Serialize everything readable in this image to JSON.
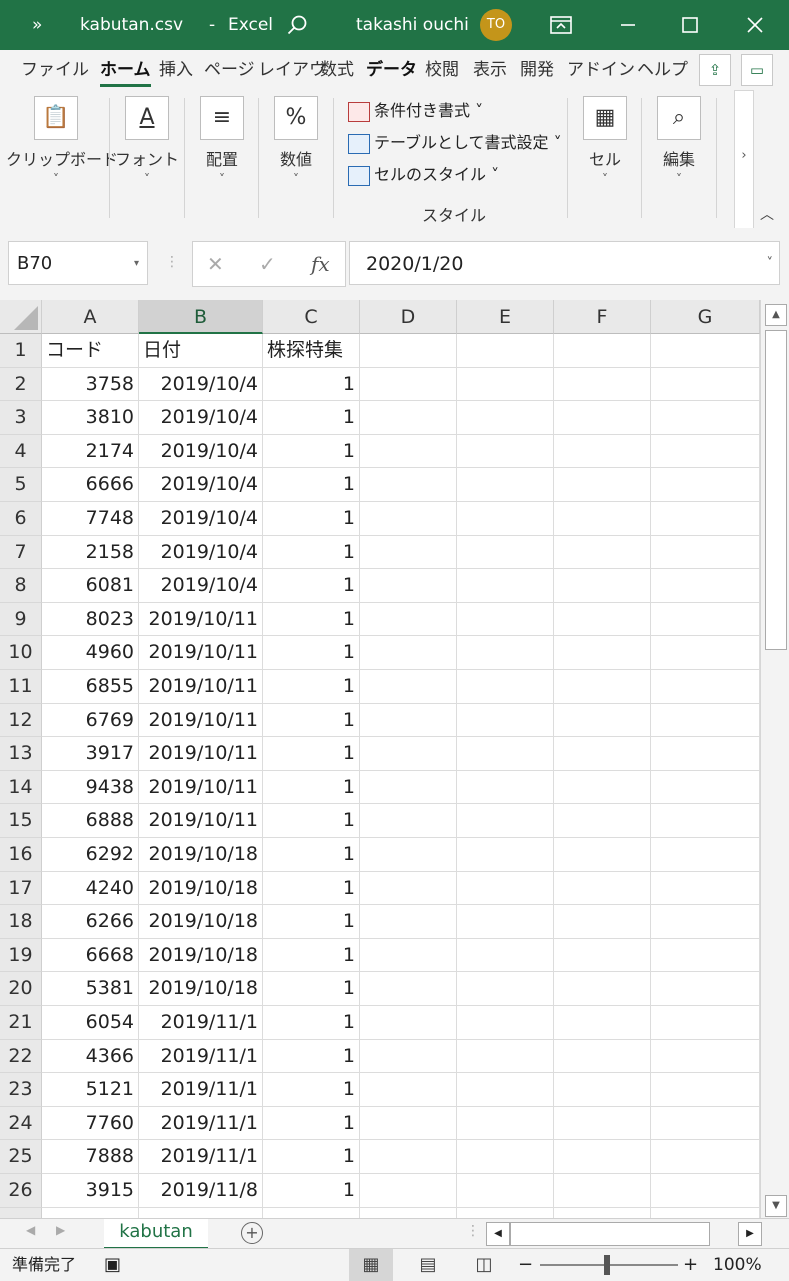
{
  "titlebar": {
    "more": "»",
    "filename": "kabutan.csv",
    "dash": "-",
    "app": "Excel",
    "user": "takashi ouchi",
    "initials": "TO"
  },
  "tabs": [
    "ファイル",
    "ホーム",
    "挿入",
    "ページ",
    "レイアウ",
    "数式",
    "データ",
    "校閲",
    "表示",
    "開発",
    "アドイン",
    "ヘルプ"
  ],
  "ribbon": {
    "clipboard": "クリップボード",
    "font": "フォント",
    "alignment": "配置",
    "number": "数値",
    "cond_format": "条件付き書式 ˅",
    "table_format": "テーブルとして書式設定 ˅",
    "cell_styles": "セルのスタイル ˅",
    "styles_group": "スタイル",
    "cells": "セル",
    "editing": "編集",
    "caret": "˅"
  },
  "formula_bar": {
    "name_box": "B70",
    "cancel": "✕",
    "enter": "✓",
    "fx": "fx",
    "value": "2020/1/20"
  },
  "columns": [
    "A",
    "B",
    "C",
    "D",
    "E",
    "F",
    "G"
  ],
  "rows": [
    {
      "n": "1",
      "a": "コード",
      "b": "日付",
      "c": "株探特集"
    },
    {
      "n": "2",
      "a": "3758",
      "b": "2019/10/4",
      "c": "1"
    },
    {
      "n": "3",
      "a": "3810",
      "b": "2019/10/4",
      "c": "1"
    },
    {
      "n": "4",
      "a": "2174",
      "b": "2019/10/4",
      "c": "1"
    },
    {
      "n": "5",
      "a": "6666",
      "b": "2019/10/4",
      "c": "1"
    },
    {
      "n": "6",
      "a": "7748",
      "b": "2019/10/4",
      "c": "1"
    },
    {
      "n": "7",
      "a": "2158",
      "b": "2019/10/4",
      "c": "1"
    },
    {
      "n": "8",
      "a": "6081",
      "b": "2019/10/4",
      "c": "1"
    },
    {
      "n": "9",
      "a": "8023",
      "b": "2019/10/11",
      "c": "1"
    },
    {
      "n": "10",
      "a": "4960",
      "b": "2019/10/11",
      "c": "1"
    },
    {
      "n": "11",
      "a": "6855",
      "b": "2019/10/11",
      "c": "1"
    },
    {
      "n": "12",
      "a": "6769",
      "b": "2019/10/11",
      "c": "1"
    },
    {
      "n": "13",
      "a": "3917",
      "b": "2019/10/11",
      "c": "1"
    },
    {
      "n": "14",
      "a": "9438",
      "b": "2019/10/11",
      "c": "1"
    },
    {
      "n": "15",
      "a": "6888",
      "b": "2019/10/11",
      "c": "1"
    },
    {
      "n": "16",
      "a": "6292",
      "b": "2019/10/18",
      "c": "1"
    },
    {
      "n": "17",
      "a": "4240",
      "b": "2019/10/18",
      "c": "1"
    },
    {
      "n": "18",
      "a": "6266",
      "b": "2019/10/18",
      "c": "1"
    },
    {
      "n": "19",
      "a": "6668",
      "b": "2019/10/18",
      "c": "1"
    },
    {
      "n": "20",
      "a": "5381",
      "b": "2019/10/18",
      "c": "1"
    },
    {
      "n": "21",
      "a": "6054",
      "b": "2019/11/1",
      "c": "1"
    },
    {
      "n": "22",
      "a": "4366",
      "b": "2019/11/1",
      "c": "1"
    },
    {
      "n": "23",
      "a": "5121",
      "b": "2019/11/1",
      "c": "1"
    },
    {
      "n": "24",
      "a": "7760",
      "b": "2019/11/1",
      "c": "1"
    },
    {
      "n": "25",
      "a": "7888",
      "b": "2019/11/1",
      "c": "1"
    },
    {
      "n": "26",
      "a": "3915",
      "b": "2019/11/8",
      "c": "1"
    }
  ],
  "sheet": {
    "name": "kabutan"
  },
  "status": {
    "ready": "準備完了",
    "zoom": "100%",
    "minus": "−",
    "plus": "+"
  }
}
